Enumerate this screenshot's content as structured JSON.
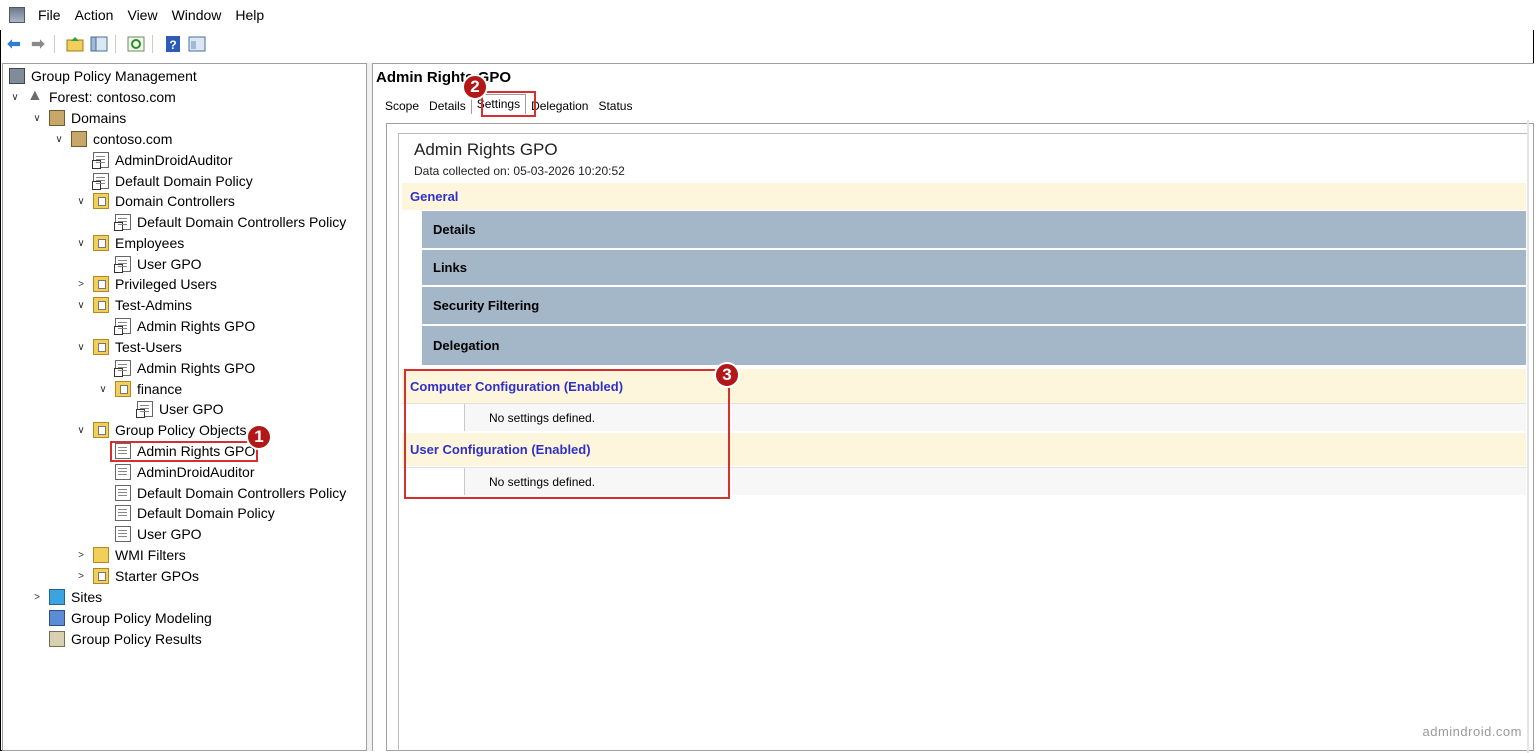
{
  "menubar": {
    "items": [
      "File",
      "Action",
      "View",
      "Window",
      "Help"
    ]
  },
  "tree": [
    {
      "label": "Group Policy Management",
      "icon": "gpm-icon"
    },
    {
      "label": "Forest: contoso.com",
      "icon": "forest-icon"
    },
    {
      "label": "Domains",
      "icon": "domains-icon"
    },
    {
      "label": "contoso.com",
      "icon": "domain-icon"
    },
    {
      "label": "AdminDroidAuditor",
      "icon": "gpo-link-icon"
    },
    {
      "label": "Default Domain Policy",
      "icon": "gpo-link-icon"
    },
    {
      "label": "Domain Controllers",
      "icon": "ou-folder-icon"
    },
    {
      "label": "Default Domain Controllers Policy",
      "icon": "gpo-link-icon"
    },
    {
      "label": "Employees",
      "icon": "ou-folder-icon"
    },
    {
      "label": "User GPO",
      "icon": "gpo-link-icon"
    },
    {
      "label": "Privileged Users",
      "icon": "ou-folder-icon"
    },
    {
      "label": "Test-Admins",
      "icon": "ou-folder-icon"
    },
    {
      "label": "Admin Rights GPO",
      "icon": "gpo-link-icon"
    },
    {
      "label": "Test-Users",
      "icon": "ou-folder-icon"
    },
    {
      "label": "Admin Rights GPO",
      "icon": "gpo-link-icon"
    },
    {
      "label": "finance",
      "icon": "ou-folder-icon"
    },
    {
      "label": "User GPO",
      "icon": "gpo-link-icon"
    },
    {
      "label": "Group Policy Objects",
      "icon": "gpo-container-icon"
    },
    {
      "label": "Admin Rights GPO",
      "icon": "gpo-icon"
    },
    {
      "label": "AdminDroidAuditor",
      "icon": "gpo-icon"
    },
    {
      "label": "Default Domain Controllers Policy",
      "icon": "gpo-icon"
    },
    {
      "label": "Default Domain Policy",
      "icon": "gpo-icon"
    },
    {
      "label": "User GPO",
      "icon": "gpo-icon"
    },
    {
      "label": "WMI Filters",
      "icon": "wmi-filters-icon"
    },
    {
      "label": "Starter GPOs",
      "icon": "starter-gpos-icon"
    },
    {
      "label": "Sites",
      "icon": "sites-icon"
    },
    {
      "label": "Group Policy Modeling",
      "icon": "modeling-icon"
    },
    {
      "label": "Group Policy Results",
      "icon": "results-icon"
    }
  ],
  "gpo": {
    "title": "Admin Rights GPO",
    "tabs": [
      "Scope",
      "Details",
      "Settings",
      "Delegation",
      "Status"
    ],
    "active_tab": "Settings"
  },
  "report": {
    "title": "Admin Rights GPO",
    "date": "Data collected on: 05-03-2026 10:20:52",
    "general": "General",
    "general_items": [
      "Details",
      "Links",
      "Security Filtering",
      "Delegation"
    ],
    "computer_config": "Computer Configuration (Enabled)",
    "user_config": "User Configuration (Enabled)",
    "no_settings": "No settings defined."
  },
  "badges": [
    "1",
    "2",
    "3"
  ],
  "watermark": "admindroid.com",
  "colors": {
    "highlight": "#d62f2f",
    "badge": "#b21818",
    "section_bg": "#fdf6dc",
    "section_text": "#3030c8",
    "subsection_bg": "#a3b7c9"
  }
}
